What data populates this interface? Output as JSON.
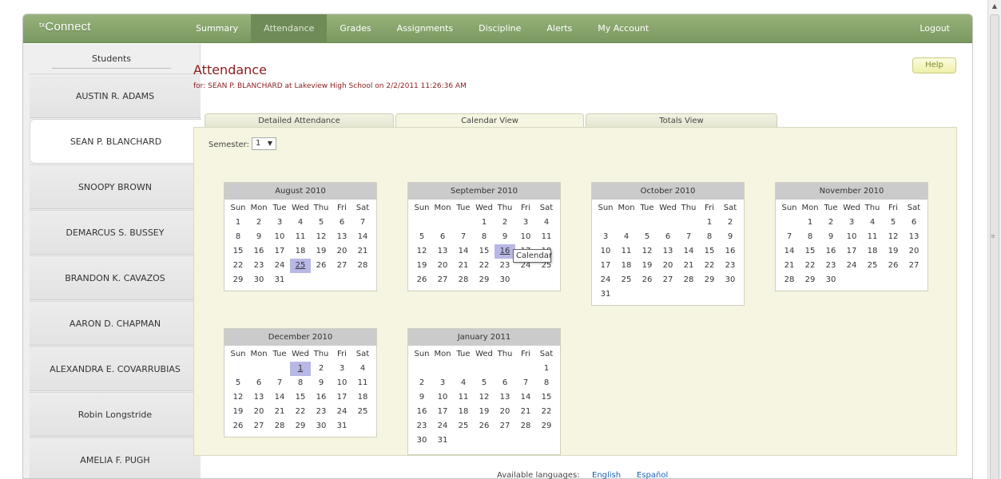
{
  "app": {
    "logo_prefix": "tx",
    "logo_main": "Connect"
  },
  "nav": {
    "items": [
      "Summary",
      "Attendance",
      "Grades",
      "Assignments",
      "Discipline",
      "Alerts",
      "My Account"
    ],
    "active": "Attendance",
    "logout": "Logout"
  },
  "sidebar": {
    "heading": "Students",
    "students": [
      "AUSTIN R. ADAMS",
      "SEAN P. BLANCHARD",
      "SNOOPY BROWN",
      "DEMARCUS S. BUSSEY",
      "BRANDON K. CAVAZOS",
      "AARON D. CHAPMAN",
      "ALEXANDRA E. COVARRUBIAS",
      "Robin Longstride",
      "AMELIA F. PUGH"
    ],
    "active": "SEAN P. BLANCHARD"
  },
  "main": {
    "title": "Attendance",
    "subtitle": "for: SEAN P. BLANCHARD at Lakeview High School on 2/2/2011 11:26:36 AM",
    "help": "Help",
    "tabs": [
      "Detailed Attendance",
      "Calendar View",
      "Totals View"
    ],
    "active_tab": "Calendar View",
    "semester_label": "Semester:",
    "semester_value": "1",
    "tooltip": "Calendar"
  },
  "calendar": {
    "weekdays": [
      "Sun",
      "Mon",
      "Tue",
      "Wed",
      "Thu",
      "Fri",
      "Sat"
    ],
    "months": [
      {
        "name": "August 2010",
        "start": 0,
        "days": 31,
        "marked": [
          25
        ]
      },
      {
        "name": "September 2010",
        "start": 3,
        "days": 30,
        "marked": [
          16
        ]
      },
      {
        "name": "October 2010",
        "start": 5,
        "days": 31,
        "marked": []
      },
      {
        "name": "November 2010",
        "start": 1,
        "days": 30,
        "marked": []
      },
      {
        "name": "December 2010",
        "start": 3,
        "days": 31,
        "marked": [
          1
        ]
      },
      {
        "name": "January 2011",
        "start": 6,
        "days": 31,
        "marked": []
      }
    ]
  },
  "footer": {
    "label": "Available languages:",
    "english": "English",
    "spanish": "Español"
  }
}
